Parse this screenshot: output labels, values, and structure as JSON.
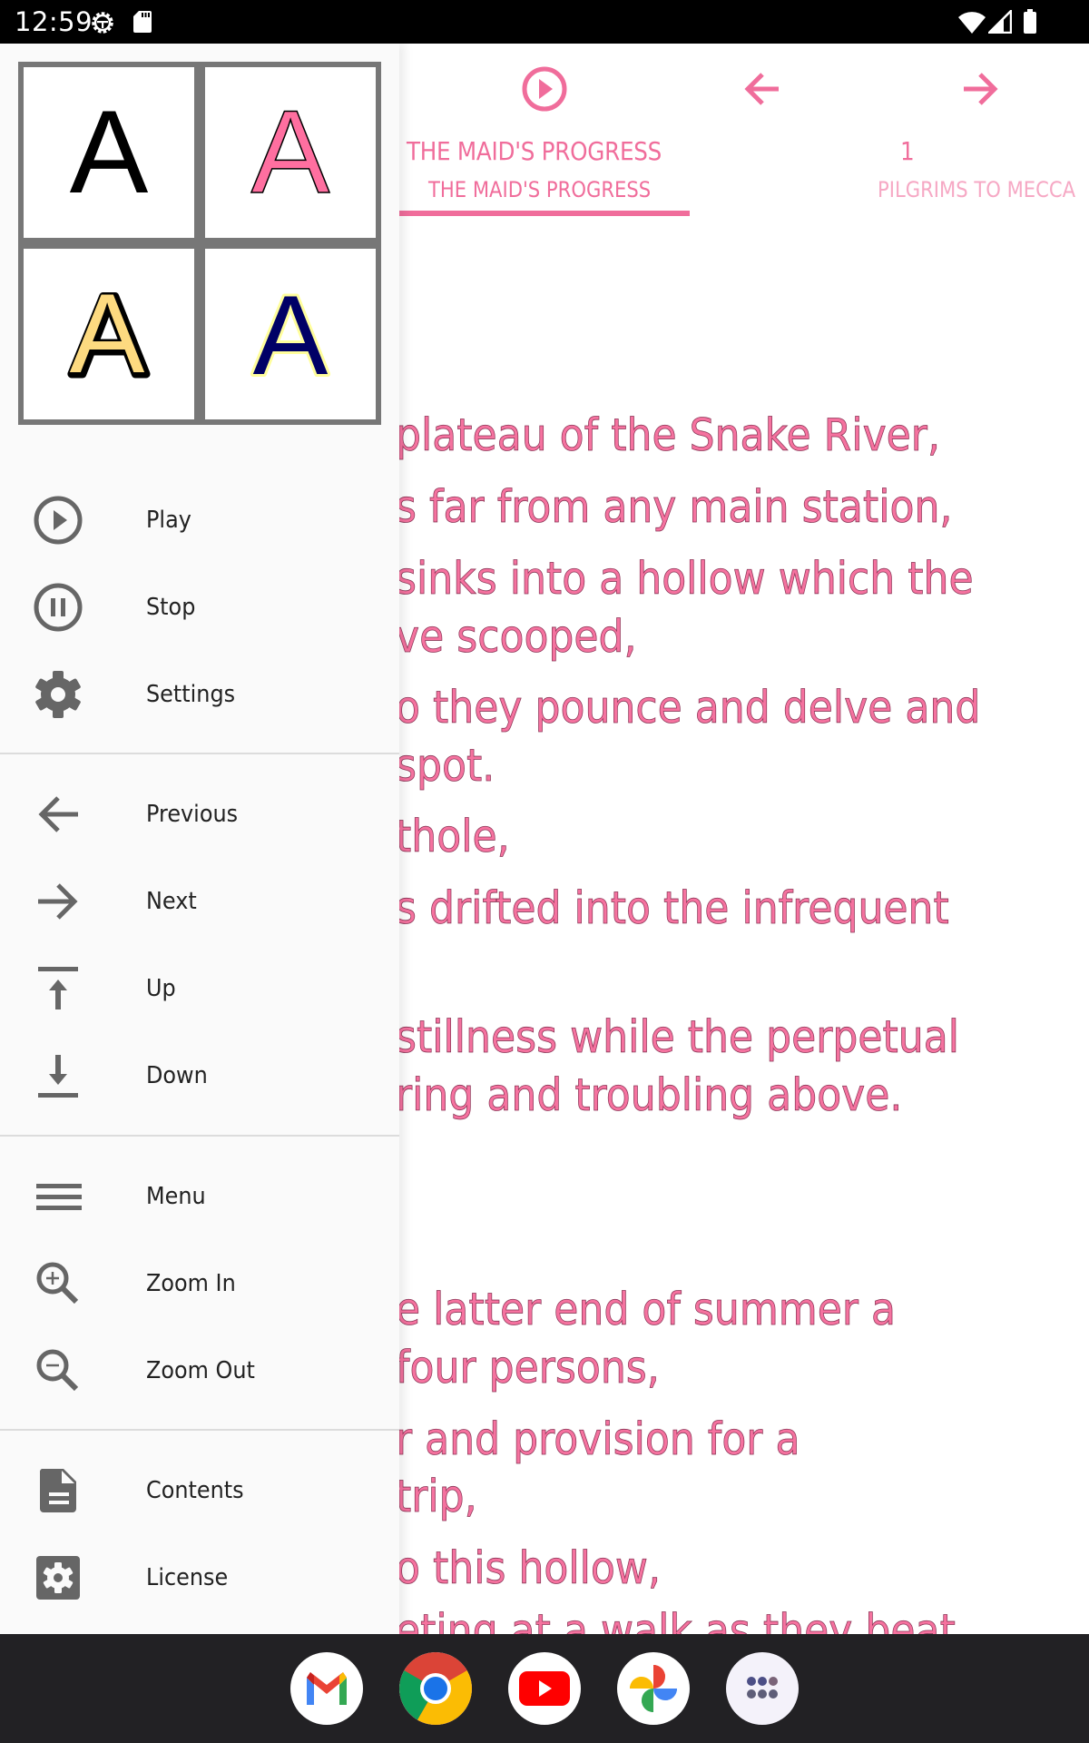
{
  "status_bar": {
    "time": "12:59",
    "left_icons": [
      "android-settings-icon",
      "sd-card-icon"
    ],
    "right_icons": [
      "wifi-icon",
      "cellular-signal-icon",
      "battery-icon"
    ]
  },
  "reader": {
    "accent_color": "#f06d9b",
    "toolbar_icons": [
      "play-icon",
      "arrow-back-icon",
      "arrow-forward-icon"
    ],
    "tabs": [
      {
        "title": "THE MAID'S PROGRESS",
        "subtitle": "THE MAID'S PROGRESS",
        "active": true
      },
      {
        "title": "1",
        "subtitle": "PILGRIMS TO MECCA",
        "active": false
      }
    ],
    "lines": [
      "plateau of the Snake River,",
      "s far from any main station,",
      "sinks into a hollow which the",
      "ve scooped,",
      "o they pounce and delve and",
      "spot.",
      "thole,",
      "s drifted into the infrequent",
      "stillness while the perpetual",
      "ring and troubling above.",
      "e latter end of summer a",
      "four persons,",
      "r and provision for a",
      "trip,",
      "o this hollow,",
      "eting at a walk as they beat"
    ]
  },
  "drawer": {
    "font_styles": [
      {
        "name": "plain-black",
        "letter": "A",
        "fill": "#000000",
        "stroke": "none"
      },
      {
        "name": "pink",
        "letter": "A",
        "fill": "#ff6fa0",
        "stroke": "#000000"
      },
      {
        "name": "yellow-outlined",
        "letter": "A",
        "fill": "#fdda80",
        "stroke": "#000000"
      },
      {
        "name": "navy-glow",
        "letter": "A",
        "fill": "#000066",
        "stroke": "#fffe9c"
      }
    ],
    "groups": [
      [
        {
          "label": "Play",
          "icon": "play-circle-icon"
        },
        {
          "label": "Stop",
          "icon": "pause-circle-icon"
        },
        {
          "label": "Settings",
          "icon": "gear-icon"
        }
      ],
      [
        {
          "label": "Previous",
          "icon": "arrow-back-icon"
        },
        {
          "label": "Next",
          "icon": "arrow-forward-icon"
        },
        {
          "label": "Up",
          "icon": "vertical-align-top-icon"
        },
        {
          "label": "Down",
          "icon": "vertical-align-bottom-icon"
        }
      ],
      [
        {
          "label": "Menu",
          "icon": "hamburger-menu-icon"
        },
        {
          "label": "Zoom In",
          "icon": "zoom-in-icon"
        },
        {
          "label": "Zoom Out",
          "icon": "zoom-out-icon"
        }
      ],
      [
        {
          "label": "Contents",
          "icon": "document-icon"
        },
        {
          "label": "License",
          "icon": "settings-application-icon"
        }
      ]
    ]
  },
  "dock": {
    "apps": [
      "Gmail",
      "Chrome",
      "YouTube",
      "Photos",
      "App drawer"
    ]
  }
}
